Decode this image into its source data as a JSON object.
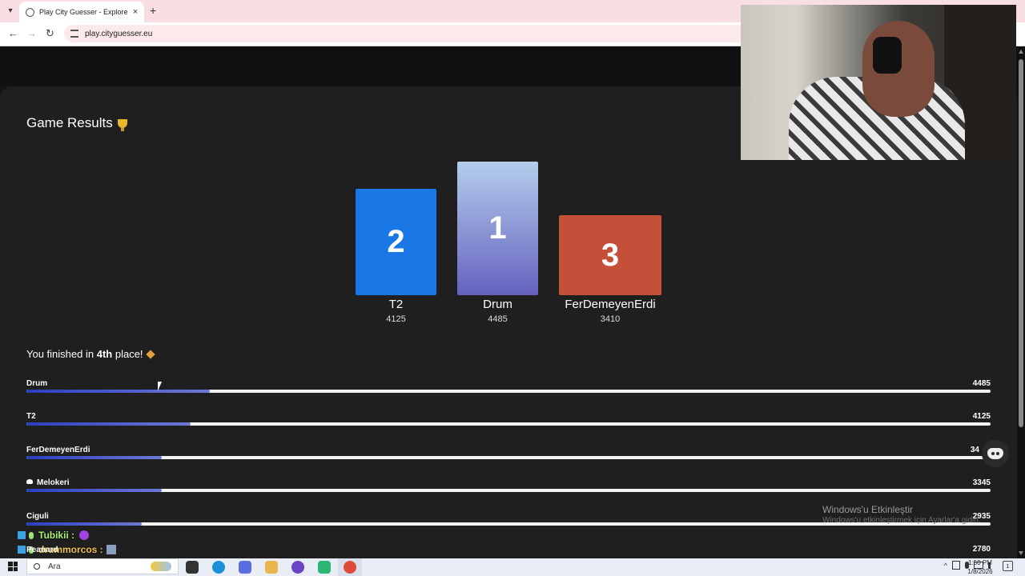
{
  "browser": {
    "tab_title": "Play City Guesser - Explore the W",
    "tab_close": "×",
    "newtab_label": "+",
    "url": "play.cityguesser.eu",
    "back": "←",
    "forward": "→",
    "reload": "↻"
  },
  "game": {
    "title": "Game Results",
    "trophy_icon": "trophy-icon",
    "podium": [
      {
        "rank": "2",
        "name": "T2",
        "score": "4125",
        "color": "#1977e6"
      },
      {
        "rank": "1",
        "name": "Drum",
        "score": "4485",
        "color": "#6562bf"
      },
      {
        "rank": "3",
        "name": "FerDemeyenErdi",
        "score": "3410",
        "color": "#c4503a"
      }
    ],
    "finish_prefix": "You finished in",
    "finish_place": "4th",
    "finish_suffix": "place!",
    "leaderboard": [
      {
        "name": "Drum",
        "score": "4485",
        "progress": 0.19
      },
      {
        "name": "T2",
        "score": "4125",
        "progress": 0.17
      },
      {
        "name": "FerDemeyenErdi",
        "score": "34",
        "progress": 0.14
      },
      {
        "name": "Melokeri",
        "score": "3345",
        "progress": 0.14,
        "icon": "pin-icon"
      },
      {
        "name": "Ciguli",
        "score": "2935",
        "progress": 0.12
      }
    ],
    "extra_score": "2780"
  },
  "overlay": {
    "watermark_title": "Windows'u Etkinleştir",
    "watermark_sub": "Windows'u etkinleştirmek için Ayarlar'a gidin.",
    "chat": [
      {
        "user": "Tubikii :"
      },
      {
        "user": "drummorcos :"
      }
    ],
    "chat_fragment": "Peanard"
  },
  "taskbar": {
    "search_placeholder": "Ara",
    "time": "1:50 PM",
    "date": "1/8/2026",
    "notification_count": "1"
  }
}
